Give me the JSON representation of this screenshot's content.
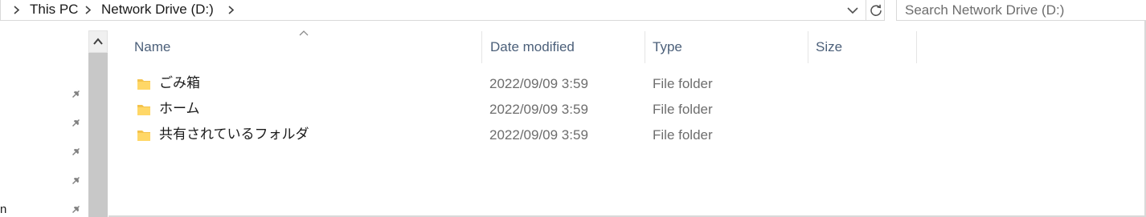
{
  "address_bar": {
    "breadcrumbs": [
      "This PC",
      "Network Drive (D:)"
    ]
  },
  "search": {
    "placeholder": "Search Network Drive (D:)"
  },
  "nav_pane": {
    "cut_text": "n"
  },
  "columns": {
    "name": "Name",
    "date_modified": "Date modified",
    "type": "Type",
    "size": "Size",
    "sorted_by": "Name",
    "sort_direction": "ascending"
  },
  "files": [
    {
      "name": "ごみ箱",
      "date_modified": "2022/09/09 3:59",
      "type": "File folder",
      "size": "",
      "icon": "folder-icon"
    },
    {
      "name": "ホーム",
      "date_modified": "2022/09/09 3:59",
      "type": "File folder",
      "size": "",
      "icon": "folder-icon"
    },
    {
      "name": "共有されているフォルダ",
      "date_modified": "2022/09/09 3:59",
      "type": "File folder",
      "size": "",
      "icon": "folder-icon"
    }
  ],
  "colors": {
    "folder": "#f4c34c",
    "header_text": "#4c607a",
    "secondary_text": "#6d6d6d",
    "scrollbar": "#c8c8c8"
  }
}
